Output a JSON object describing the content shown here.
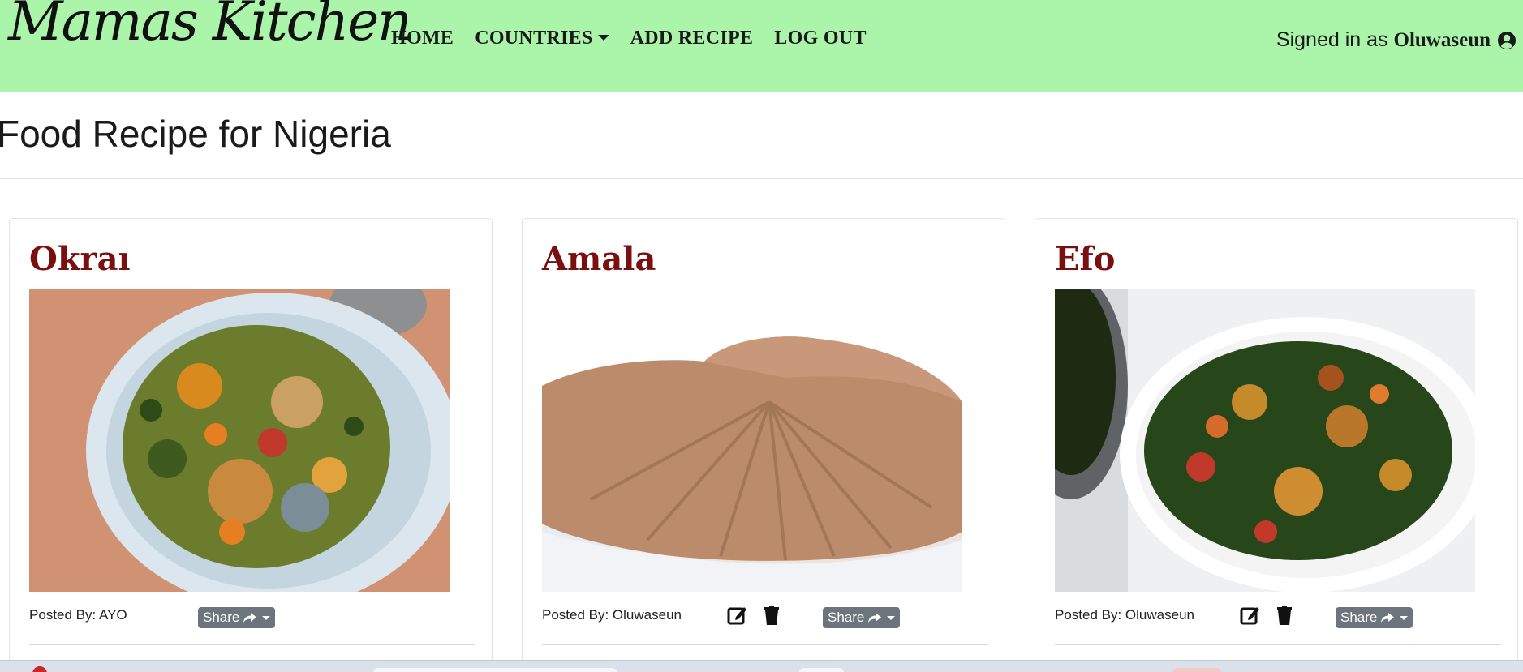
{
  "navbar": {
    "brand": "Mamas Kitchen",
    "links": [
      {
        "label": "HOME"
      },
      {
        "label": "COUNTRIES",
        "dropdown": true
      },
      {
        "label": "ADD RECIPE"
      },
      {
        "label": "LOG OUT"
      }
    ],
    "signed_in_prefix": "Signed in as",
    "username": "Oluwaseun",
    "user_icon": "user-circle-icon",
    "background": "#abf5ab"
  },
  "page": {
    "title": "Food Recipe for Nigeria"
  },
  "cards": [
    {
      "title": "Okraı",
      "posted_by": "Posted By: AYO",
      "share_label": "Share",
      "can_edit": false,
      "image": "okra-dish"
    },
    {
      "title": "Amala",
      "posted_by": "Posted By: Oluwaseun",
      "share_label": "Share",
      "can_edit": true,
      "image": "amala-dish"
    },
    {
      "title": "Efo",
      "posted_by": "Posted By: Oluwaseun",
      "share_label": "Share",
      "can_edit": true,
      "image": "efo-dish"
    }
  ],
  "colors": {
    "card_title": "#7a0f0f",
    "share_button": "#6c757d"
  }
}
